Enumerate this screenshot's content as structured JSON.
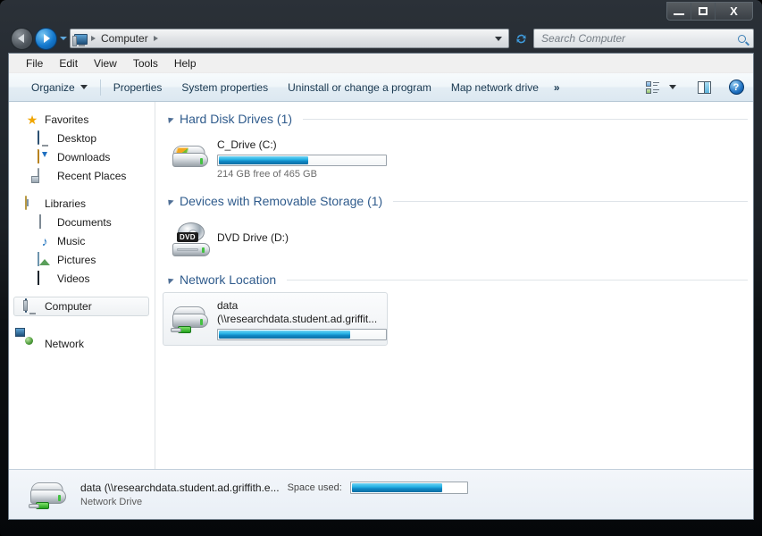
{
  "window": {
    "controls": {
      "minimize": "–",
      "maximize": "□",
      "close": "X"
    }
  },
  "navigation": {
    "back_icon": "back-arrow-icon",
    "forward_icon": "forward-arrow-icon",
    "history_icon": "history-dropdown-icon",
    "refresh_icon": "refresh-icon",
    "breadcrumb": {
      "computer_icon": "computer-icon",
      "path": "Computer"
    }
  },
  "search": {
    "placeholder": "Search Computer",
    "value": "",
    "icon": "search-icon"
  },
  "menubar": {
    "items": [
      "File",
      "Edit",
      "View",
      "Tools",
      "Help"
    ]
  },
  "toolbar": {
    "organize": "Organize",
    "properties": "Properties",
    "system_properties": "System properties",
    "uninstall": "Uninstall or change a program",
    "map_network_drive": "Map network drive",
    "overflow": "»",
    "views_icon": "view-layout-icon",
    "views_caret": "chevron-down-icon",
    "preview_icon": "preview-pane-icon",
    "help_icon": "help-icon",
    "help_glyph": "?"
  },
  "sidebar": {
    "groups": [
      {
        "header": {
          "label": "Favorites",
          "icon": "star-icon"
        },
        "items": [
          {
            "label": "Desktop",
            "icon": "desktop-icon"
          },
          {
            "label": "Downloads",
            "icon": "downloads-icon"
          },
          {
            "label": "Recent Places",
            "icon": "recent-places-icon"
          }
        ]
      },
      {
        "header": {
          "label": "Libraries",
          "icon": "libraries-icon"
        },
        "items": [
          {
            "label": "Documents",
            "icon": "documents-icon"
          },
          {
            "label": "Music",
            "icon": "music-icon"
          },
          {
            "label": "Pictures",
            "icon": "pictures-icon"
          },
          {
            "label": "Videos",
            "icon": "videos-icon"
          }
        ]
      }
    ],
    "computer": {
      "label": "Computer",
      "icon": "computer-icon",
      "selected": true
    },
    "network": {
      "label": "Network",
      "icon": "network-icon",
      "selected": false
    }
  },
  "content": {
    "groups": [
      {
        "title": "Hard Disk Drives (1)",
        "items": [
          {
            "name": "C_Drive (C:)",
            "subtitle": "214 GB free of 465 GB",
            "icon": "hard-disk-drive-icon",
            "capacity_percent": 54,
            "selected": false
          }
        ]
      },
      {
        "title": "Devices with Removable Storage (1)",
        "items": [
          {
            "name": "DVD Drive (D:)",
            "subtitle": "",
            "icon": "dvd-drive-icon",
            "badge": "DVD",
            "capacity_percent": null,
            "selected": false
          }
        ]
      },
      {
        "title": "Network Location",
        "items": [
          {
            "name": "data",
            "name_line2": "(\\\\researchdata.student.ad.griffit...",
            "subtitle": "",
            "icon": "network-drive-icon",
            "capacity_percent": 79,
            "selected": true
          }
        ]
      }
    ]
  },
  "statusbar": {
    "icon": "network-drive-icon",
    "name": "data (\\\\researchdata.student.ad.griffith.e...",
    "space_label": "Space used:",
    "type": "Network Drive",
    "space_used_percent": 79
  },
  "colors": {
    "accent_blue": "#2f5b8c",
    "capacity_fill": "#28b4e6",
    "toolbar_text": "#18374f"
  }
}
